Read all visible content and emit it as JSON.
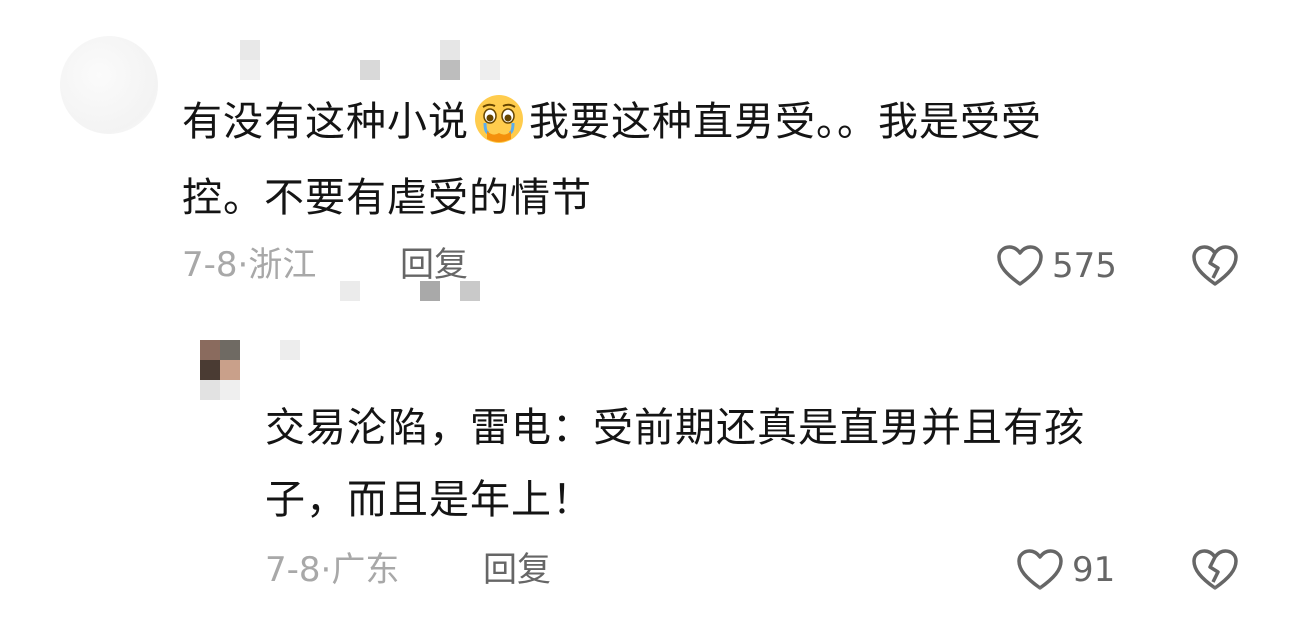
{
  "comments": [
    {
      "text_line1_before_emoji": "有没有这种小说",
      "emoji": "pleading-face-icon",
      "text_line1_after_emoji": "我要这种直男受。。我是受受",
      "text_line2": "控。不要有虐受的情节",
      "date": "7-8·",
      "location": "浙江",
      "reply_label": "回复",
      "like_count": "575"
    },
    {
      "text_line1": "交易沦陷，雷电：受前期还真是直男并且有孩",
      "text_line2": "子，而且是年上！",
      "date": "7-8·",
      "location": "广东",
      "reply_label": "回复",
      "like_count": "91"
    }
  ],
  "colors": {
    "text": "#141414",
    "meta": "#a8a8a8",
    "reply": "#666666",
    "icon": "#666666"
  }
}
